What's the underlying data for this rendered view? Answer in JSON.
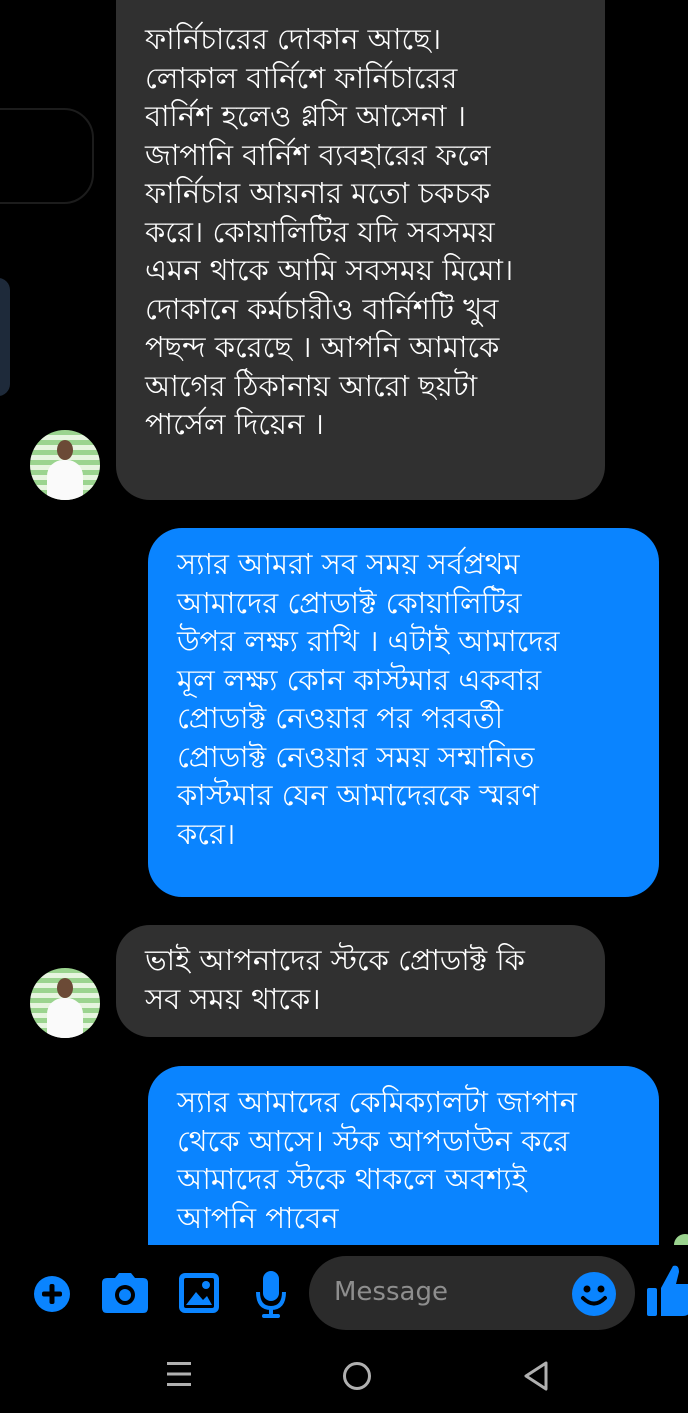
{
  "conversation": {
    "messages": [
      {
        "direction": "incoming",
        "text": "ফার্নিচারের দোকান আছে।\nলোকাল  বার্নিশে ফার্নিচারের\nবার্নিশ হলেও গ্লসি আসেনা ।\nজাপানি বার্নিশ ব্যবহারের ফলে\nফার্নিচার আয়নার মতো চকচক\nকরে। কোয়ালিটির যদি সবসময়\nএমন থাকে আমি সবসময় মিমো।\nদোকানে কর্মচারীও   বার্নিশটি খুব\nপছন্দ করেছে । আপনি আমাকে\nআগের ঠিকানায় আরো ছয়টা\nপার্সেল দিয়েন ।"
      },
      {
        "direction": "outgoing",
        "text": "স্যার আমরা সব সময় সর্বপ্রথম\nআমাদের প্রোডাক্ট কোয়ালিটির\nউপর লক্ষ্য রাখি । এটাই আমাদের\nমূল লক্ষ্য কোন কাস্টমার একবার\nপ্রোডাক্ট নেওয়ার পর পরবর্তী\nপ্রোডাক্ট নেওয়ার সময় সম্মানিত\nকাস্টমার যেন আমাদেরকে স্মরণ\nকরে।"
      },
      {
        "direction": "incoming",
        "text": "ভাই আপনাদের স্টকে  প্রোডাক্ট কি\nসব সময় থাকে।"
      },
      {
        "direction": "outgoing",
        "text": "স্যার আমাদের কেমিক্যালটা জাপান\nথেকে আসে। স্টক আপডাউন করে\nআমাদের স্টকে থাকলে অবশ্যই\nআপনি পাবেন"
      }
    ]
  },
  "composer": {
    "placeholder": "Message",
    "icons": [
      "plus-icon",
      "camera-icon",
      "gallery-icon",
      "microphone-icon",
      "emoji-icon",
      "thumbs-up-icon"
    ]
  },
  "navbar": {
    "icons": [
      "recent-apps-icon",
      "home-icon",
      "back-icon"
    ]
  },
  "colors": {
    "background": "#000000",
    "incoming_bubble": "#303030",
    "outgoing_bubble": "#0a84ff",
    "accent": "#0a84ff",
    "placeholder_text": "#8e8e8e"
  }
}
